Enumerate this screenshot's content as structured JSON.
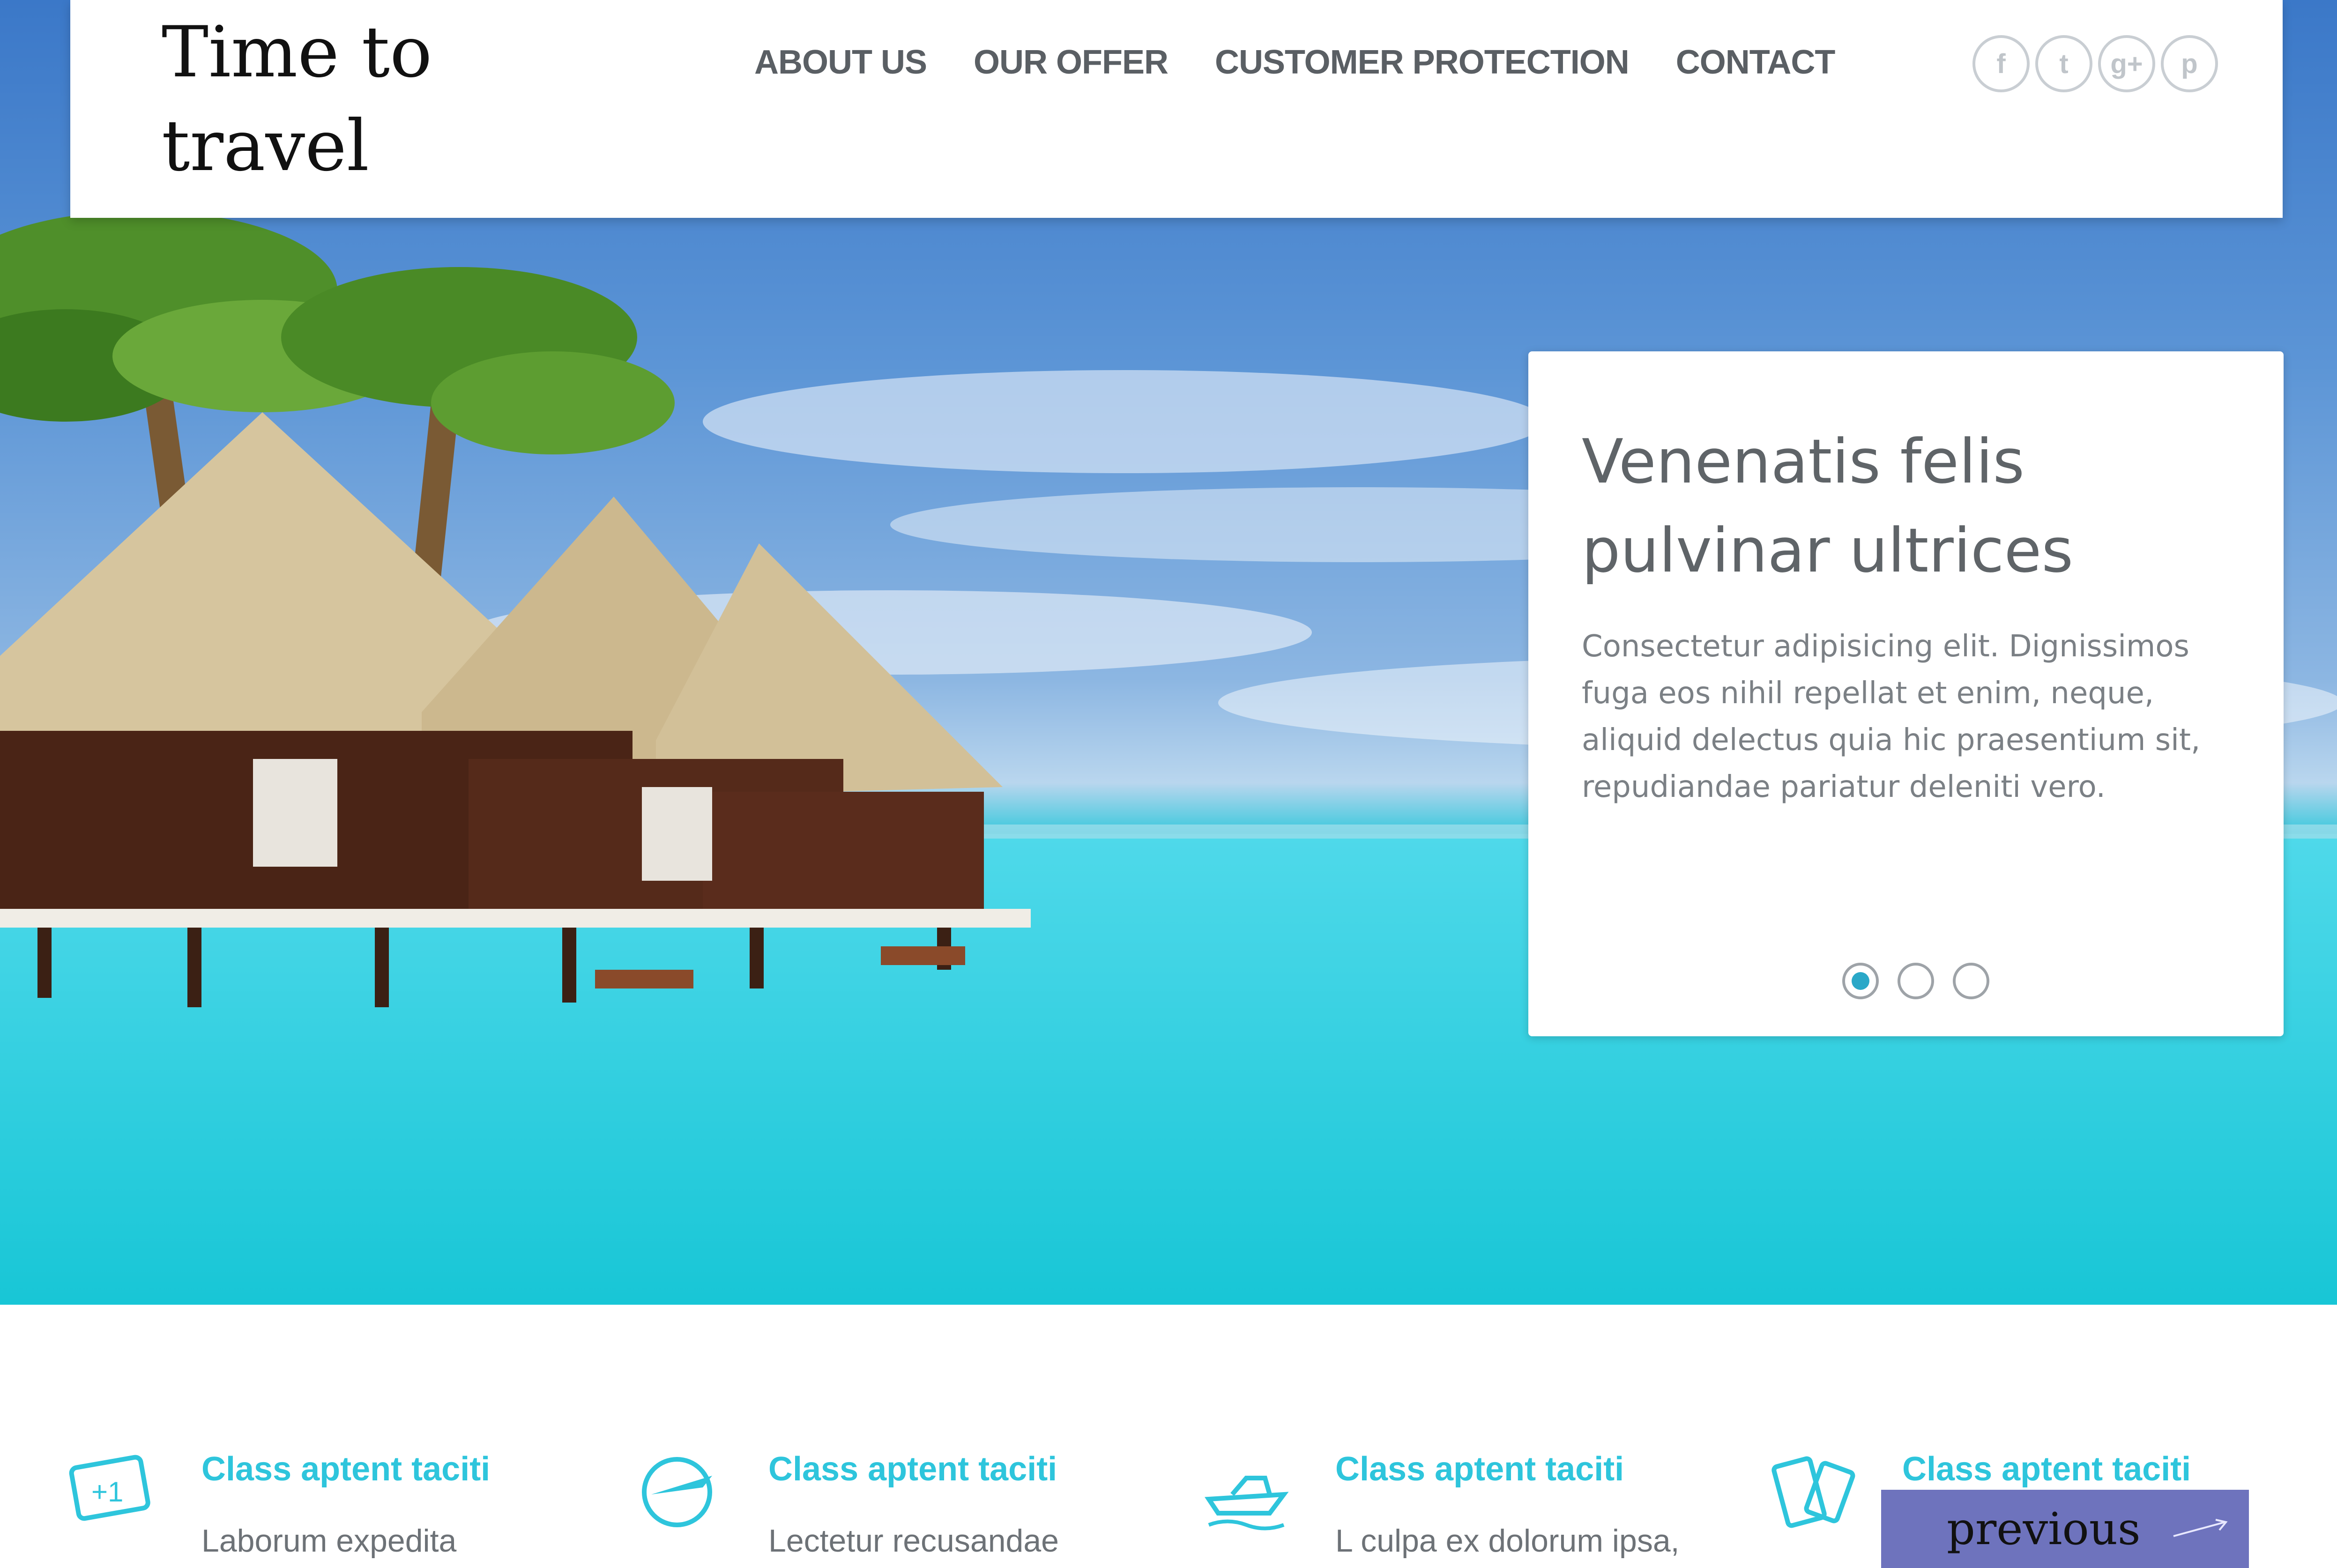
{
  "header": {
    "brand": "Time to\ntravel",
    "nav": [
      {
        "label": "ABOUT US"
      },
      {
        "label": "OUR OFFER"
      },
      {
        "label": "CUSTOMER PROTECTION"
      },
      {
        "label": "CONTACT"
      }
    ],
    "social": [
      {
        "icon": "facebook-icon",
        "glyph": "f"
      },
      {
        "icon": "twitter-icon",
        "glyph": "t"
      },
      {
        "icon": "google-plus-icon",
        "glyph": "g+"
      },
      {
        "icon": "pinterest-icon",
        "glyph": "p"
      }
    ]
  },
  "hero_card": {
    "title": "Venenatis felis pulvinar ultrices",
    "text": "Consectetur adipisicing elit. Dignissimos fuga eos nihil repellat et enim, neque, aliquid delectus quia hic praesentium sit, repudiandae pariatur deleniti vero.",
    "active_slide": 1,
    "slides": 3
  },
  "features": [
    {
      "icon": "ticket-icon",
      "title": "Class aptent taciti",
      "text": "Laborum expedita"
    },
    {
      "icon": "plane-globe-icon",
      "title": "Class aptent taciti",
      "text": "Lectetur recusandae"
    },
    {
      "icon": "boat-icon",
      "title": "Class aptent taciti",
      "text": "L culpa ex dolorum ipsa,"
    },
    {
      "icon": "passport-icon",
      "title": "Class aptent taciti",
      "text": ""
    }
  ],
  "prev_button": {
    "label": "previous"
  },
  "colors": {
    "accent": "#2ec5dc",
    "button": "#6e73bd"
  }
}
